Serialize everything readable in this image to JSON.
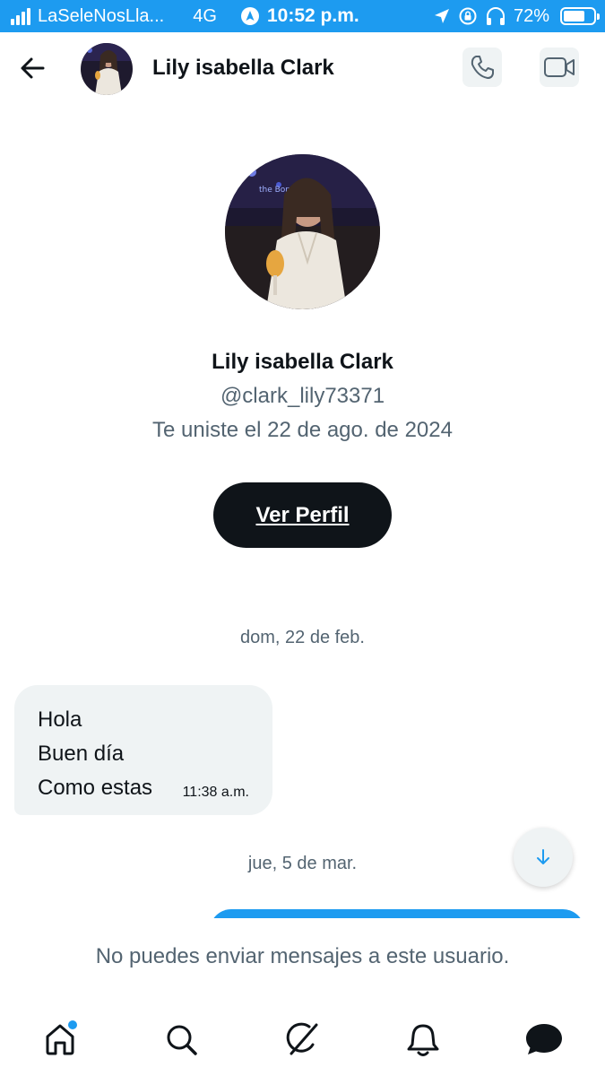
{
  "status_bar": {
    "carrier": "LaSeleNosLla...",
    "network": "4G",
    "time": "10:52 p.m.",
    "battery_percent": "72%",
    "battery_level": 0.72
  },
  "header": {
    "name": "Lily isabella Clark"
  },
  "profile": {
    "name": "Lily isabella Clark",
    "handle": "@clark_lily73371",
    "joined": "Te uniste el 22 de ago. de 2024",
    "view_profile_label": "Ver Perfil"
  },
  "conversation": {
    "date_1": "dom, 22 de feb.",
    "message_1": {
      "lines": [
        "Hola",
        "Buen día",
        "Como estas"
      ],
      "time": "11:38 a.m."
    },
    "date_2": "jue, 5 de mar."
  },
  "footer": {
    "blocked_note": "No puedes enviar mensajes a este usuario."
  },
  "colors": {
    "accent": "#1d9bf0",
    "text_primary": "#0f1419",
    "text_secondary": "#536471",
    "bubble_received": "#eff3f4"
  },
  "icons": {
    "back": "arrow-left-icon",
    "call": "phone-icon",
    "video": "video-camera-icon",
    "scroll_down": "arrow-down-icon",
    "nav": [
      "home-icon",
      "search-icon",
      "grok-icon",
      "bell-icon",
      "mail-icon"
    ]
  }
}
